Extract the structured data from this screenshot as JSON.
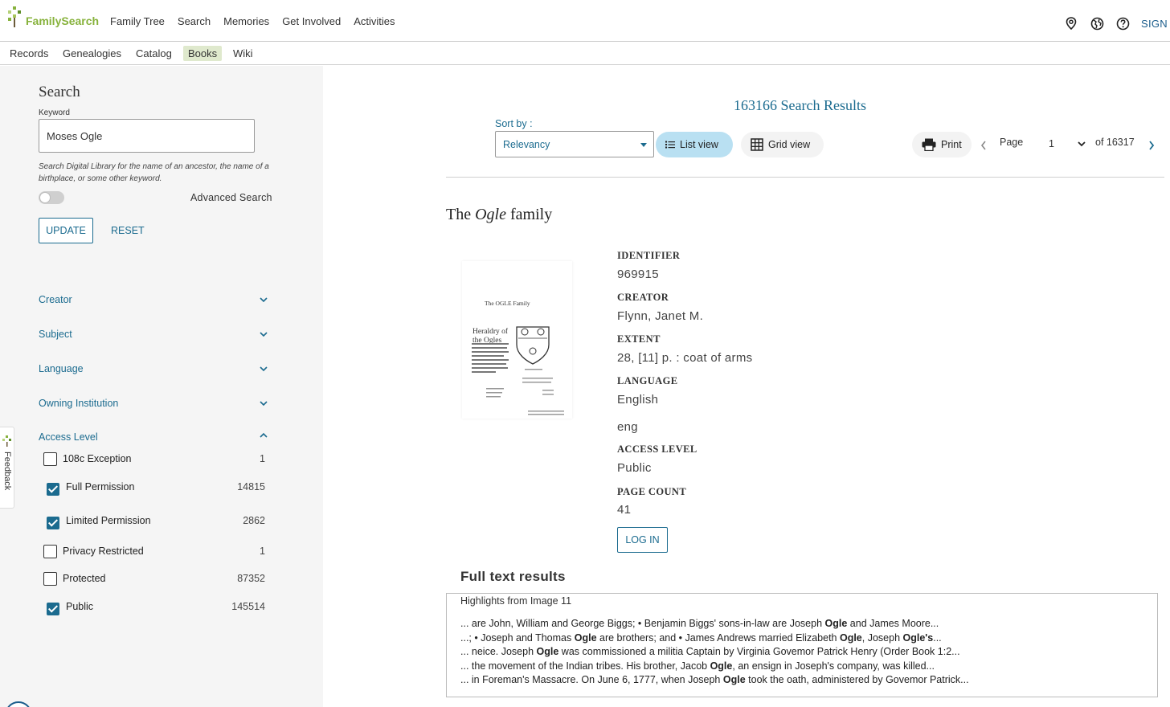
{
  "header": {
    "logo_text": "FamilySearch",
    "nav": [
      "Family Tree",
      "Search",
      "Memories",
      "Get Involved",
      "Activities"
    ],
    "sign_in": "SIGN IN"
  },
  "subnav": {
    "items": [
      "Records",
      "Genealogies",
      "Catalog",
      "Books",
      "Wiki"
    ],
    "active": "Books"
  },
  "sidebar": {
    "title": "Search",
    "keyword_label": "Keyword",
    "keyword_value": "Moses Ogle",
    "keyword_help": "Search Digital Library for the name of an ancestor, the name of a birthplace, or some other keyword.",
    "advanced_label": "Advanced Search",
    "update_label": "UPDATE",
    "reset_label": "RESET",
    "facets": [
      "Creator",
      "Subject",
      "Language",
      "Owning Institution",
      "Access Level"
    ],
    "access_levels": [
      {
        "label": "108c Exception",
        "count": "1",
        "checked": false
      },
      {
        "label": "Full Permission",
        "count": "14815",
        "checked": true
      },
      {
        "label": "Limited Permission",
        "count": "2862",
        "checked": true
      },
      {
        "label": "Privacy Restricted",
        "count": "1",
        "checked": false
      },
      {
        "label": "Protected",
        "count": "87352",
        "checked": false
      },
      {
        "label": "Public",
        "count": "145514",
        "checked": true
      }
    ],
    "feedback_label": "Feedback"
  },
  "results": {
    "count_text": "163166 Search Results",
    "sort_label": "Sort by :",
    "sort_value": "Relevancy",
    "list_view_label": "List view",
    "grid_view_label": "Grid view",
    "print_label": "Print",
    "page_label": "Page",
    "page_value": "1",
    "of_pages": "of 16317"
  },
  "book": {
    "title_pre": "The ",
    "title_em": "Ogle",
    "title_post": " family",
    "thumb_caption": "The OGLE Family",
    "thumb_heading": "Heraldry of the Ogles",
    "fields": [
      {
        "label": "IDENTIFIER",
        "value": "969915"
      },
      {
        "label": "CREATOR",
        "value": "Flynn, Janet M."
      },
      {
        "label": "EXTENT",
        "value": "28, [11] p. : coat of arms"
      },
      {
        "label": "LANGUAGE",
        "value": "English"
      },
      {
        "label": "",
        "value": "eng"
      },
      {
        "label": "ACCESS LEVEL",
        "value": "Public"
      },
      {
        "label": "PAGE COUNT",
        "value": "41"
      }
    ],
    "login_label": "LOG IN"
  },
  "full_text": {
    "title": "Full text results",
    "highlights_label": "Highlights from Image 11",
    "lines": [
      [
        [
          "... are John, William and George Biggs; • Benjamin Biggs' sons-in-law are Joseph ",
          false
        ],
        [
          "Ogle",
          true
        ],
        [
          " and James Moore...",
          false
        ]
      ],
      [
        [
          "...; • Joseph and Thomas ",
          false
        ],
        [
          "Ogle",
          true
        ],
        [
          " are brothers; and • James Andrews married Elizabeth ",
          false
        ],
        [
          "Ogle",
          true
        ],
        [
          ", Joseph ",
          false
        ],
        [
          "Ogle's",
          true
        ],
        [
          "...",
          false
        ]
      ],
      [
        [
          "... neice. Joseph ",
          false
        ],
        [
          "Ogle",
          true
        ],
        [
          " was commissioned a militia Captain by Virginia Govemor Patrick Henry (Order Book 1:2...",
          false
        ]
      ],
      [
        [
          "... the movement of the Indian tribes. His brother, Jacob ",
          false
        ],
        [
          "Ogle",
          true
        ],
        [
          ", an ensign in Joseph's company, was killed...",
          false
        ]
      ],
      [
        [
          "... in Foreman's Massacre. On June 6, 1777, when Joseph ",
          false
        ],
        [
          "Ogle",
          true
        ],
        [
          " took the oath, administered by Govemor Patrick...",
          false
        ]
      ]
    ]
  },
  "colors": {
    "brand_green": "#87b23c",
    "link_blue": "#1b6b8f",
    "list_view_active": "#b9e0f2"
  }
}
